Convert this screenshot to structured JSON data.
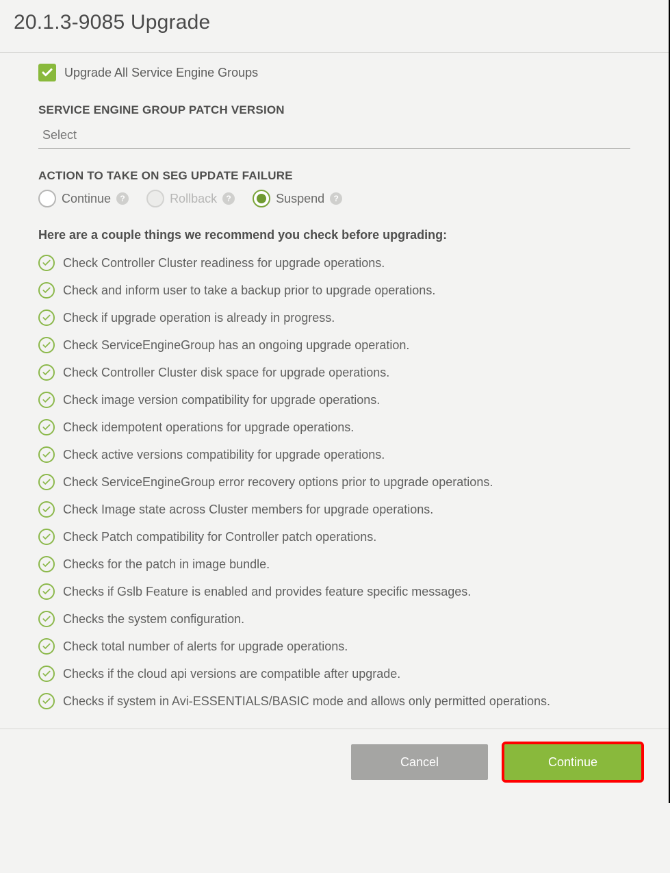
{
  "header": {
    "title": "20.1.3-9085 Upgrade"
  },
  "upgrade_all": {
    "checked": true,
    "label": "Upgrade All Service Engine Groups"
  },
  "patch_version": {
    "label": "SERVICE ENGINE GROUP PATCH VERSION",
    "placeholder": "Select",
    "value": ""
  },
  "failure_action": {
    "label": "ACTION TO TAKE ON SEG UPDATE FAILURE",
    "options": {
      "continue": "Continue",
      "rollback": "Rollback",
      "suspend": "Suspend"
    },
    "selected": "suspend"
  },
  "recommend": {
    "intro": "Here are a couple things we recommend you check before upgrading:",
    "items": [
      "Check Controller Cluster readiness for upgrade operations.",
      "Check and inform user to take a backup prior to upgrade operations.",
      "Check if upgrade operation is already in progress.",
      "Check ServiceEngineGroup has an ongoing upgrade operation.",
      "Check Controller Cluster disk space for upgrade operations.",
      "Check image version compatibility for upgrade operations.",
      "Check idempotent operations for upgrade operations.",
      "Check active versions compatibility for upgrade operations.",
      "Check ServiceEngineGroup error recovery options prior to upgrade operations.",
      "Check Image state across Cluster members for upgrade operations.",
      "Check Patch compatibility for Controller patch operations.",
      "Checks for the patch in image bundle.",
      "Checks if Gslb Feature is enabled and provides feature specific messages.",
      "Checks the system configuration.",
      "Check total number of alerts for upgrade operations.",
      "Checks if the cloud api versions are compatible after upgrade.",
      "Checks if system in Avi-ESSENTIALS/BASIC mode and allows only permitted operations."
    ]
  },
  "footer": {
    "cancel": "Cancel",
    "continue": "Continue"
  },
  "colors": {
    "accent": "#89b93c",
    "highlight_border": "#ff0000"
  }
}
